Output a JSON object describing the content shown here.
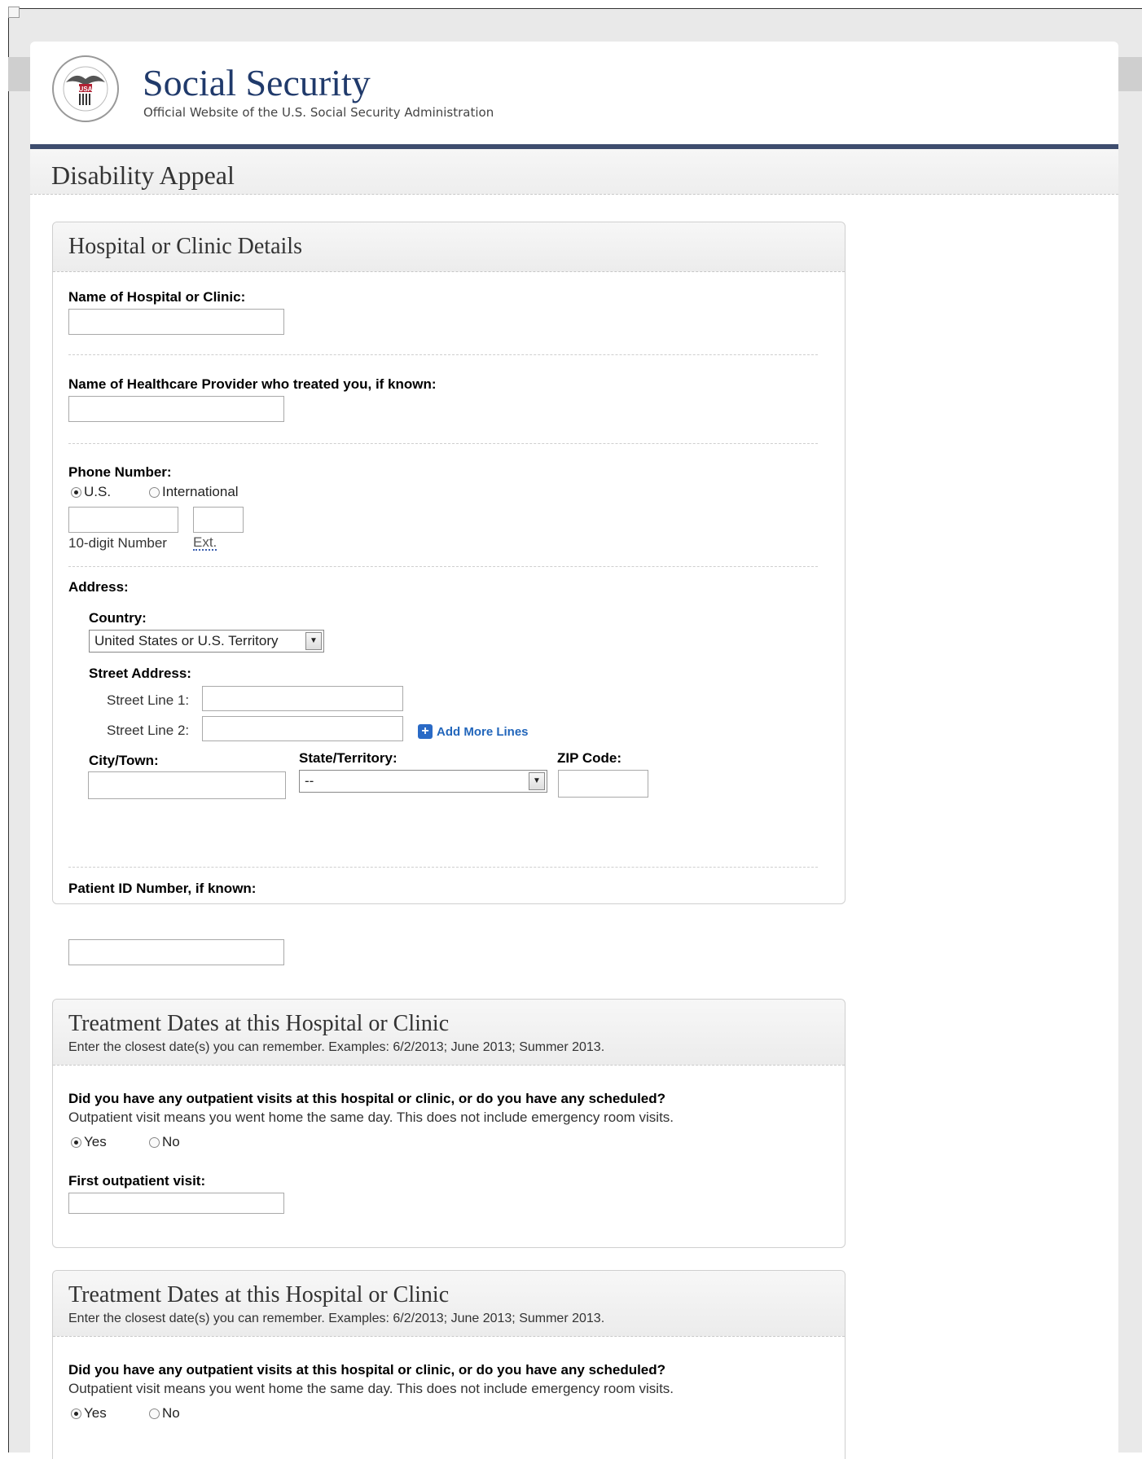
{
  "brand": {
    "seal_text": "SOCIAL SECURITY ADMINISTRATION",
    "seal_usa": "USA",
    "title": "Social Security",
    "subtitle": "Official Website of the U.S. Social Security Administration"
  },
  "page_title": "Disability Appeal",
  "hospital_panel": {
    "title": "Hospital or Clinic Details",
    "hospital_name_label": "Name of Hospital or Clinic:",
    "hospital_name_value": "",
    "provider_label": "Name of Healthcare Provider who treated you, if known:",
    "provider_value": "",
    "phone": {
      "label": "Phone Number:",
      "options": [
        "U.S.",
        "International"
      ],
      "selected": "U.S.",
      "number_hint": "10-digit Number",
      "ext_hint": "Ext.",
      "number_value": "",
      "ext_value": ""
    },
    "address": {
      "label": "Address:",
      "country_label": "Country:",
      "country_value": "United States or U.S. Territory",
      "street_label": "Street Address:",
      "street_line1_label": "Street Line 1:",
      "street_line2_label": "Street Line 2:",
      "add_more_lines": "Add More Lines",
      "city_label": "City/Town:",
      "state_label": "State/Territory:",
      "state_value": "--",
      "zip_label": "ZIP Code:"
    },
    "patient_id_label": "Patient ID Number, if known:",
    "patient_id_value": ""
  },
  "treatment_panels": [
    {
      "title": "Treatment Dates at this Hospital or Clinic",
      "subtitle": "Enter the closest date(s) you can remember. Examples: 6/2/2013; June 2013; Summer 2013.",
      "question": "Did you have any outpatient visits at this hospital or clinic, or do you have any scheduled?",
      "question_note": "Outpatient visit means you went home the same day. This does not include emergency room visits.",
      "options": [
        "Yes",
        "No"
      ],
      "selected": "Yes",
      "first_visit_label": "First outpatient visit:",
      "first_visit_value": ""
    },
    {
      "title": "Treatment Dates at this Hospital or Clinic",
      "subtitle": "Enter the closest date(s) you can remember. Examples: 6/2/2013; June 2013; Summer 2013.",
      "question": "Did you have any outpatient visits at this hospital or clinic, or do you have any scheduled?",
      "question_note": "Outpatient visit means you went home the same day. This does not include emergency room visits.",
      "options": [
        "Yes",
        "No"
      ],
      "selected": "Yes"
    }
  ],
  "colors": {
    "brand_blue": "#203a6b",
    "header_rule": "#3e4d6e",
    "link_blue": "#2266bb"
  }
}
